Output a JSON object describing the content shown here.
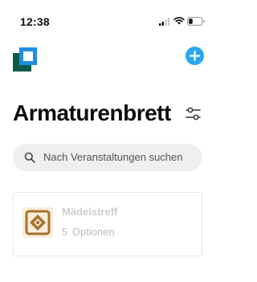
{
  "status_bar": {
    "time": "12:38"
  },
  "colors": {
    "accent": "#29a6f0",
    "logo_dark": "#0f5a4c",
    "logo_blue": "#1f8fe6",
    "thumb_bg": "#f7edd9",
    "thumb_brown": "#a8722c"
  },
  "header": {
    "logo_icon": "app-logo",
    "add_icon": "plus-icon"
  },
  "page": {
    "title": "Armaturenbrett",
    "filter_icon": "sliders-icon"
  },
  "search": {
    "placeholder": "Nach Veranstaltungen suchen"
  },
  "events": [
    {
      "name": "Mädelstreff",
      "options_count": "5",
      "options_label": "Optionen"
    }
  ]
}
